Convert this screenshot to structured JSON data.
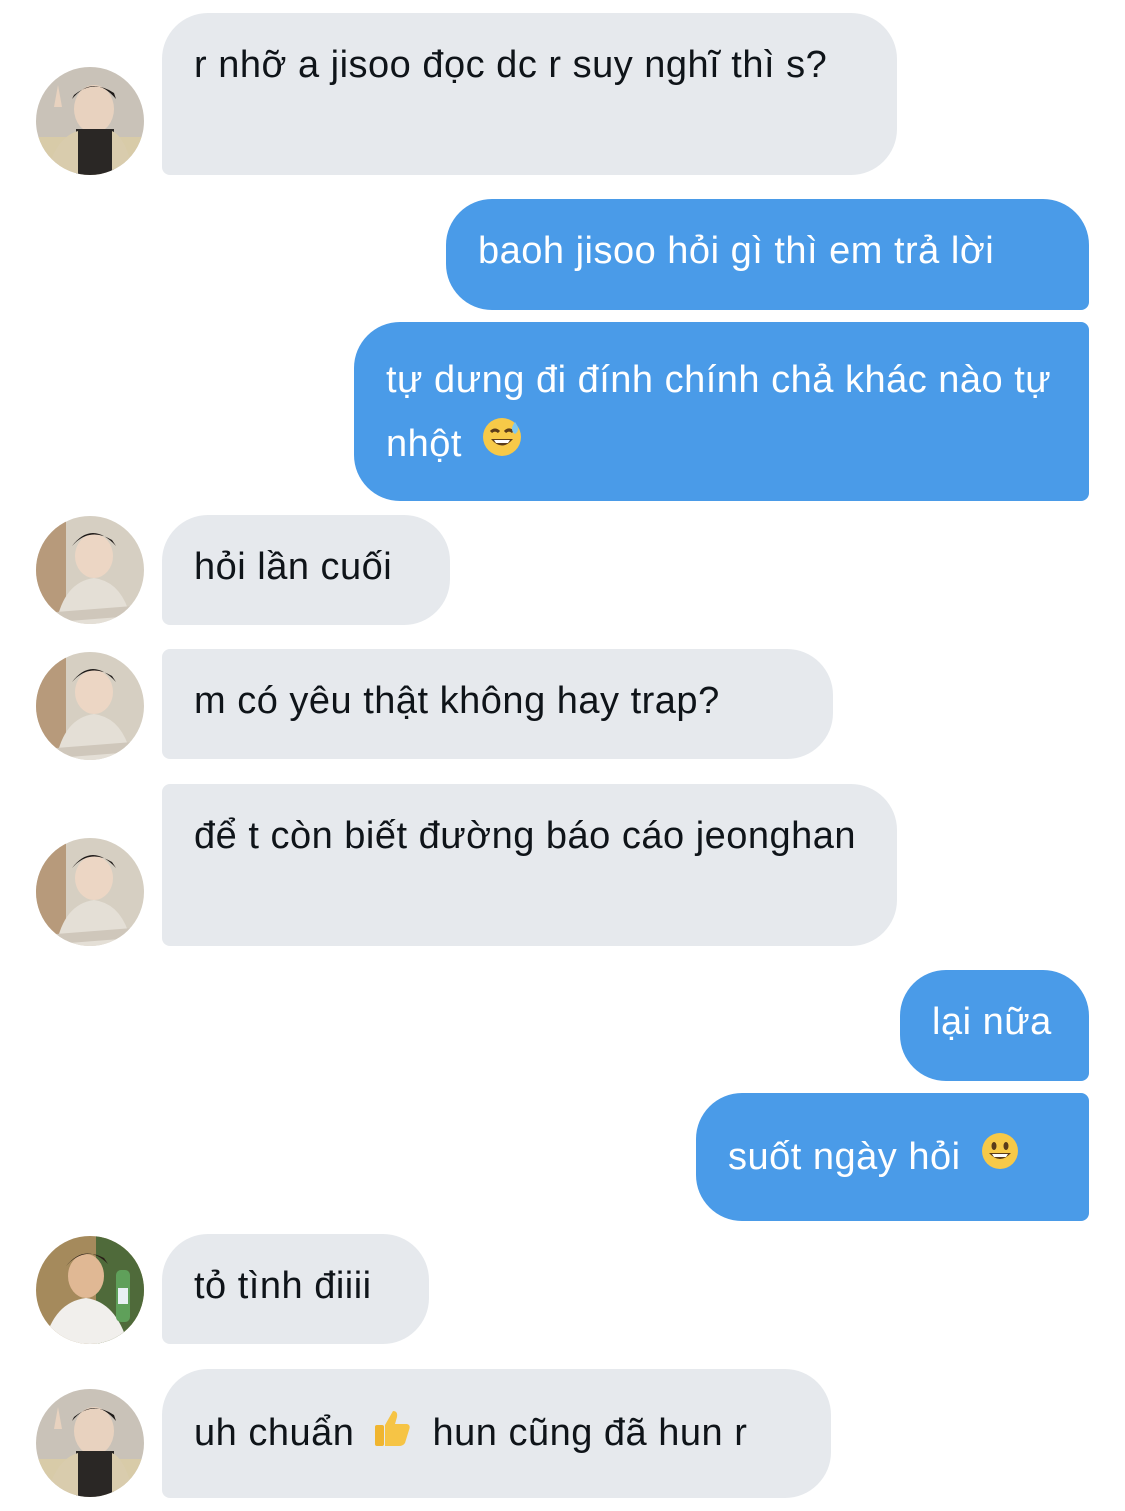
{
  "messages": [
    {
      "side": "in",
      "text": "r nhỡ a jisoo đọc dc r suy nghĩ thì s?",
      "avatar": "avatar-1"
    },
    {
      "side": "out",
      "text": "baoh jisoo hỏi gì thì em trả lời"
    },
    {
      "side": "out",
      "text": "tự dưng đi đính chính chả khác nào tự nhột",
      "emoji": "grinning-sweat-emoji"
    },
    {
      "side": "in",
      "text": "hỏi lần cuối",
      "avatar": "avatar-2"
    },
    {
      "side": "in",
      "text": "m có yêu thật không hay trap?",
      "avatar": "avatar-2"
    },
    {
      "side": "in",
      "text": "để t còn biết đường báo cáo jeonghan",
      "avatar": "avatar-2"
    },
    {
      "side": "out",
      "text": "lại nữa"
    },
    {
      "side": "out",
      "text": "suốt ngày hỏi",
      "emoji": "grinning-emoji"
    },
    {
      "side": "in",
      "text": "tỏ tình điiii",
      "avatar": "avatar-3"
    },
    {
      "side": "in",
      "text": "uh chuẩn",
      "text_after": "hun cũng đã hun r",
      "emoji": "thumbs-up-emoji",
      "avatar": "avatar-1"
    }
  ],
  "colors": {
    "incoming": "#e6e9ed",
    "outgoing": "#4a9be8"
  }
}
